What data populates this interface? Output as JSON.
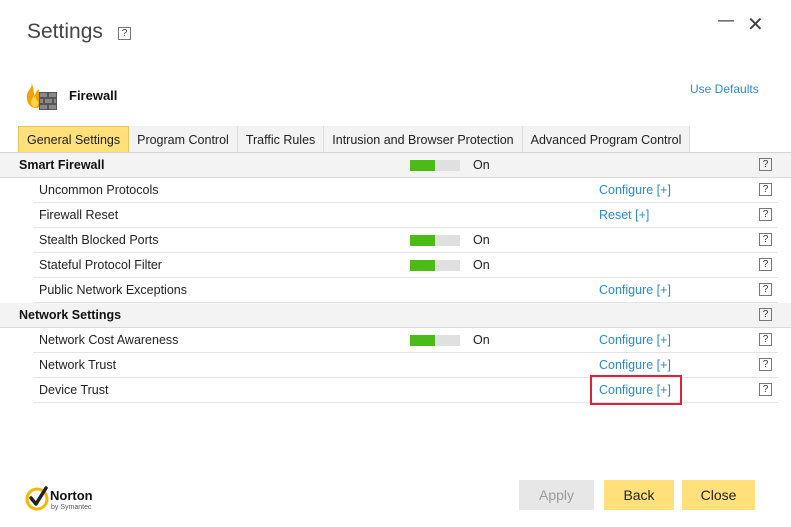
{
  "window": {
    "title": "Settings",
    "help_label": "?",
    "minimize_glyph": "—",
    "close_glyph": "✕"
  },
  "header": {
    "section_label": "Firewall",
    "use_defaults_label": "Use Defaults"
  },
  "tabs": [
    {
      "label": "General Settings",
      "active": true
    },
    {
      "label": "Program Control",
      "active": false
    },
    {
      "label": "Traffic Rules",
      "active": false
    },
    {
      "label": "Intrusion and Browser Protection",
      "active": false
    },
    {
      "label": "Advanced Program Control",
      "active": false
    }
  ],
  "sections": {
    "smart_firewall": {
      "label": "Smart Firewall",
      "toggle_state": "On",
      "toggle_level": 0.5
    },
    "network_settings": {
      "label": "Network Settings"
    }
  },
  "items": {
    "uncommon_protocols": {
      "label": "Uncommon Protocols",
      "action": "Configure [+]"
    },
    "firewall_reset": {
      "label": "Firewall Reset",
      "action": "Reset [+]"
    },
    "stealth_blocked_ports": {
      "label": "Stealth Blocked Ports",
      "toggle_state": "On",
      "toggle_level": 0.5
    },
    "stateful_protocol_filter": {
      "label": "Stateful Protocol Filter",
      "toggle_state": "On",
      "toggle_level": 0.5
    },
    "public_network_exceptions": {
      "label": "Public Network Exceptions",
      "action": "Configure [+]"
    },
    "network_cost_awareness": {
      "label": "Network Cost Awareness",
      "toggle_state": "On",
      "toggle_level": 0.5,
      "action": "Configure [+]"
    },
    "network_trust": {
      "label": "Network Trust",
      "action": "Configure [+]"
    },
    "device_trust": {
      "label": "Device Trust",
      "action": "Configure [+]"
    }
  },
  "branding": {
    "name": "Norton",
    "sub": "by Symantec"
  },
  "footer": {
    "apply_label": "Apply",
    "back_label": "Back",
    "close_label": "Close"
  },
  "colors": {
    "accent_yellow": "#ffe07a",
    "toggle_green": "#4cbb17",
    "link_blue": "#2a8bc8",
    "highlight_red": "#e01f3d"
  }
}
